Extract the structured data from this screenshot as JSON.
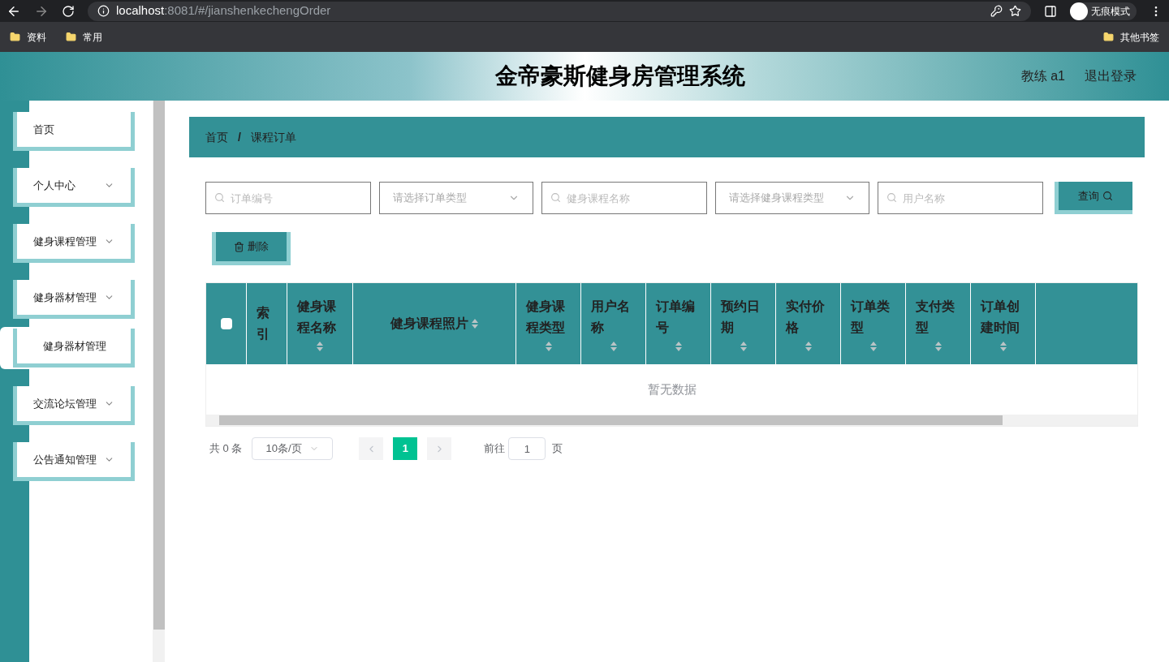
{
  "browser": {
    "url_host": "localhost",
    "url_rest": ":8081/#/jianshenkechengOrder",
    "profile": "无痕模式",
    "bookmarks": [
      "资料",
      "常用"
    ],
    "other_bookmarks": "其他书签"
  },
  "header": {
    "title": "金帝豪斯健身房管理系统",
    "user": "教练 a1",
    "logout": "退出登录"
  },
  "sidebar": {
    "items": [
      {
        "label": "首页",
        "has_arrow": false
      },
      {
        "label": "个人中心",
        "has_arrow": true
      },
      {
        "label": "健身课程管理",
        "has_arrow": true
      },
      {
        "label": "健身器材管理",
        "has_arrow": true,
        "children": [
          {
            "label": "健身器材管理"
          }
        ]
      },
      {
        "label": "交流论坛管理",
        "has_arrow": true
      },
      {
        "label": "公告通知管理",
        "has_arrow": true
      }
    ]
  },
  "breadcrumb": {
    "items": [
      "首页",
      "课程订单"
    ],
    "separator": "/"
  },
  "filters": [
    {
      "kind": "search",
      "placeholder": "订单编号"
    },
    {
      "kind": "select",
      "placeholder": "请选择订单类型"
    },
    {
      "kind": "search",
      "placeholder": "健身课程名称"
    },
    {
      "kind": "select",
      "placeholder": "请选择健身课程类型"
    },
    {
      "kind": "search",
      "placeholder": "用户名称"
    }
  ],
  "query_button": "查询",
  "delete_button": "删除",
  "table": {
    "select_all_checked": false,
    "columns": [
      {
        "label": "索引",
        "sortable": false
      },
      {
        "label": "健身课程名称",
        "sortable": true
      },
      {
        "label": "健身课程照片",
        "sortable": true
      },
      {
        "label": "健身课程类型",
        "sortable": true
      },
      {
        "label": "用户名称",
        "sortable": true
      },
      {
        "label": "订单编号",
        "sortable": true
      },
      {
        "label": "预约日期",
        "sortable": true
      },
      {
        "label": "实付价格",
        "sortable": true
      },
      {
        "label": "订单类型",
        "sortable": true
      },
      {
        "label": "支付类型",
        "sortable": true
      },
      {
        "label": "订单创建时间",
        "sortable": true
      }
    ],
    "empty_text": "暂无数据"
  },
  "pagination": {
    "total": "共 0 条",
    "page_size": "10条/页",
    "pages": [
      {
        "label": "1",
        "selected": true
      }
    ],
    "goto_label": "前往",
    "goto_value": "1",
    "page_unit": "页"
  }
}
